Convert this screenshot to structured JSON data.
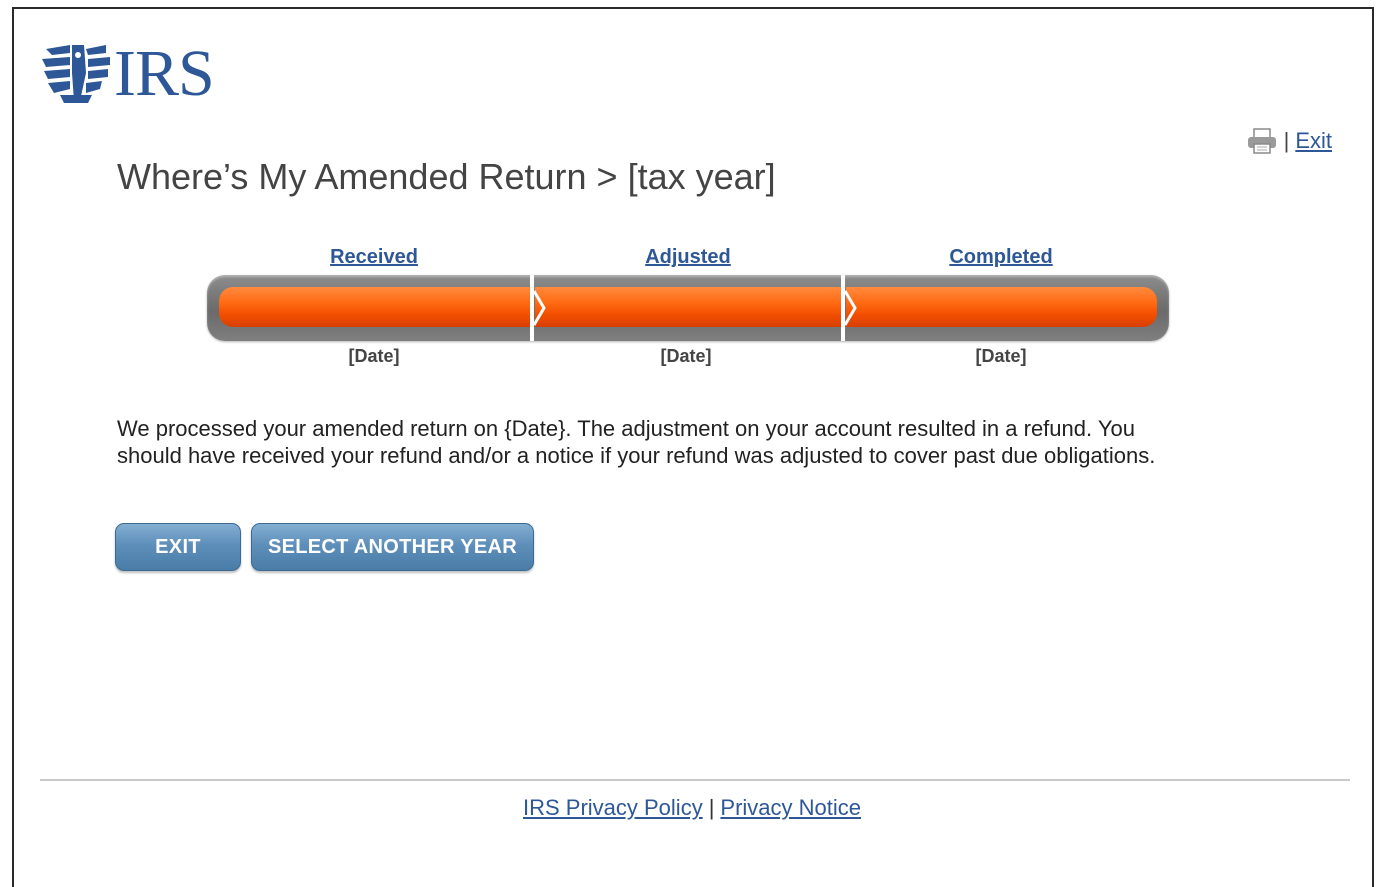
{
  "brand": {
    "name": "IRS",
    "color": "#2d5797"
  },
  "header": {
    "print_icon": "printer-icon",
    "separator": "|",
    "exit_label": "Exit"
  },
  "page_title": "Where’s My Amended Return > [tax year]",
  "tracker": {
    "steps": [
      {
        "label": "Received",
        "date": "[Date]",
        "complete": true
      },
      {
        "label": "Adjusted",
        "date": "[Date]",
        "complete": true
      },
      {
        "label": "Completed",
        "date": "[Date]",
        "complete": true
      }
    ],
    "fill_color": "#ff6a12",
    "track_color": "#7a7a7a"
  },
  "message": "We processed your amended return on {Date}. The adjustment on your account resulted in a refund. You should have received your refund and/or a notice if your refund was adjusted to cover past due obligations.",
  "buttons": {
    "exit": "EXIT",
    "select_year": "SELECT ANOTHER YEAR"
  },
  "footer": {
    "privacy_policy": "IRS Privacy Policy",
    "separator": "|",
    "privacy_notice": "Privacy Notice"
  }
}
